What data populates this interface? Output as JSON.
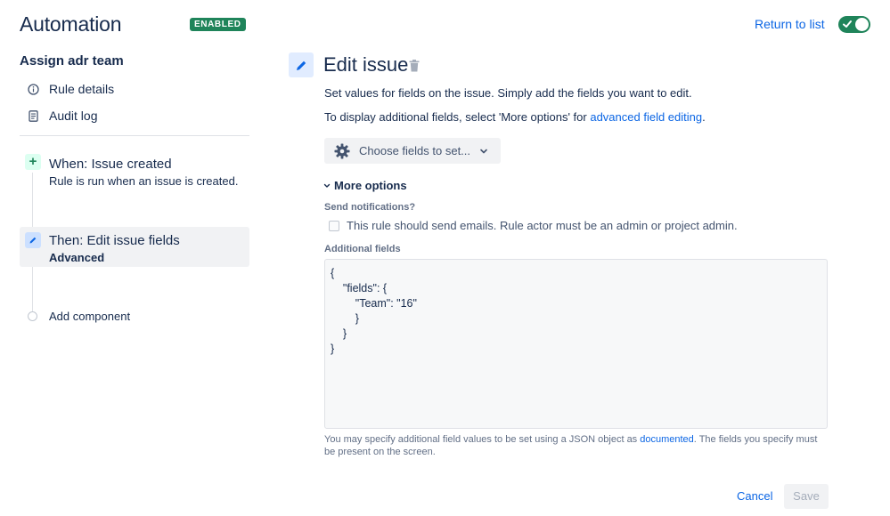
{
  "header": {
    "title": "Automation",
    "status_badge": "ENABLED",
    "return_link": "Return to list",
    "toggle_on": true,
    "accent_color": "#1f845a"
  },
  "sidebar": {
    "rule_name": "Assign adr team",
    "links": [
      {
        "label": "Rule details",
        "icon": "info-icon"
      },
      {
        "label": "Audit log",
        "icon": "document-icon"
      }
    ],
    "trigger": {
      "title": "When: Issue created",
      "description": "Rule is run when an issue is created.",
      "icon": "plus-icon"
    },
    "action": {
      "title": "Then: Edit issue fields",
      "subtitle": "Advanced",
      "icon": "pencil-icon"
    },
    "add_component": "Add component"
  },
  "main": {
    "title": "Edit issue",
    "description_1": "Set values for fields on the issue. Simply add the fields you want to edit.",
    "description_2_prefix": "To display additional fields, select 'More options' for ",
    "description_2_link": "advanced field editing",
    "description_2_suffix": ".",
    "choose_fields_label": "Choose fields to set...",
    "more_options_label": "More options",
    "send_notifications_label": "Send notifications?",
    "send_notifications_checkbox": "This rule should send emails. Rule actor must be an admin or project admin.",
    "send_notifications_checked": false,
    "additional_fields_label": "Additional fields",
    "additional_fields_value": "{\n    \"fields\": {\n        \"Team\": \"16\"\n        }\n    }\n}",
    "help_prefix": "You may specify additional field values to be set using a JSON object as ",
    "help_link": "documented",
    "help_suffix": ". The fields you specify must be present on the screen.",
    "cancel_label": "Cancel",
    "save_label": "Save"
  }
}
